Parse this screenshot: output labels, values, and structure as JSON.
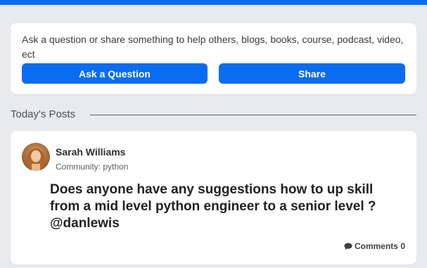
{
  "share_box": {
    "prompt": "Ask a question or share something to help others, blogs, books, course, podcast, video, ect",
    "ask_label": "Ask a Question",
    "share_label": "Share"
  },
  "feed": {
    "section_title": "Today's Posts"
  },
  "post": {
    "author": "Sarah Williams",
    "community": "Community: python",
    "body": "Does anyone have any suggestions how to up skill from a mid level python engineer to a senior level ? @danlewis",
    "comments_label": "Comments 0"
  },
  "icons": {
    "comments": "comment-bubble-icon",
    "avatar": "user-avatar"
  },
  "colors": {
    "accent": "#0a6cf0",
    "background": "#e9eaed",
    "card": "#ffffff"
  }
}
